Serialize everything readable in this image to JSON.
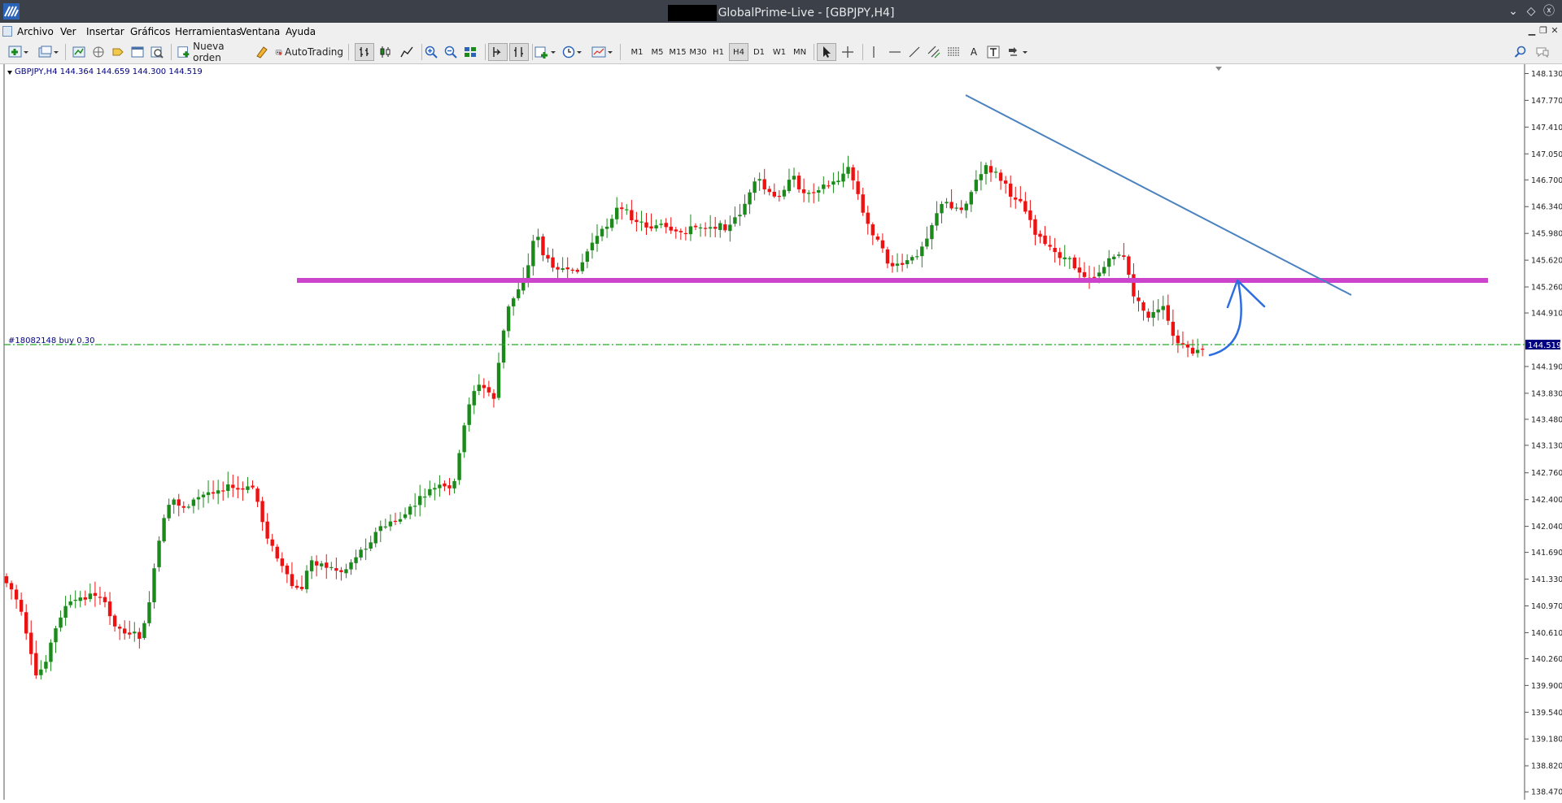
{
  "window": {
    "title": "GlobalPrime-Live - [GBPJPY,H4]",
    "controls": [
      "minimize",
      "restore",
      "close"
    ]
  },
  "menu": {
    "items": [
      "Archivo",
      "Ver",
      "Insertar",
      "Gráficos",
      "Herramientas",
      "Ventana",
      "Ayuda"
    ]
  },
  "toolbar": {
    "new_order_label": "Nueva orden",
    "autotrading_label": "AutoTrading",
    "timeframes": [
      "M1",
      "M5",
      "M15",
      "M30",
      "H1",
      "H4",
      "D1",
      "W1",
      "MN"
    ],
    "active_timeframe": "H4"
  },
  "chart": {
    "info": "GBPJPY,H4  144.364 144.659 144.300 144.519",
    "order_label": "#18082148 buy 0.30",
    "current_price": "144.519",
    "price_ticks": [
      "148.130",
      "147.770",
      "147.410",
      "147.050",
      "146.700",
      "146.340",
      "145.980",
      "145.620",
      "145.260",
      "144.910",
      "144.190",
      "143.830",
      "143.480",
      "143.130",
      "142.760",
      "142.400",
      "142.040",
      "141.690",
      "141.330",
      "140.970",
      "140.610",
      "140.260",
      "139.900",
      "139.540",
      "139.180",
      "138.820",
      "138.470"
    ],
    "colors": {
      "bull": "#1b8a1b",
      "bear": "#ee1111",
      "support": "#cc44cc",
      "trend": "#4a82c0",
      "order": "#22aa22",
      "arrow": "#2c6de0"
    }
  }
}
